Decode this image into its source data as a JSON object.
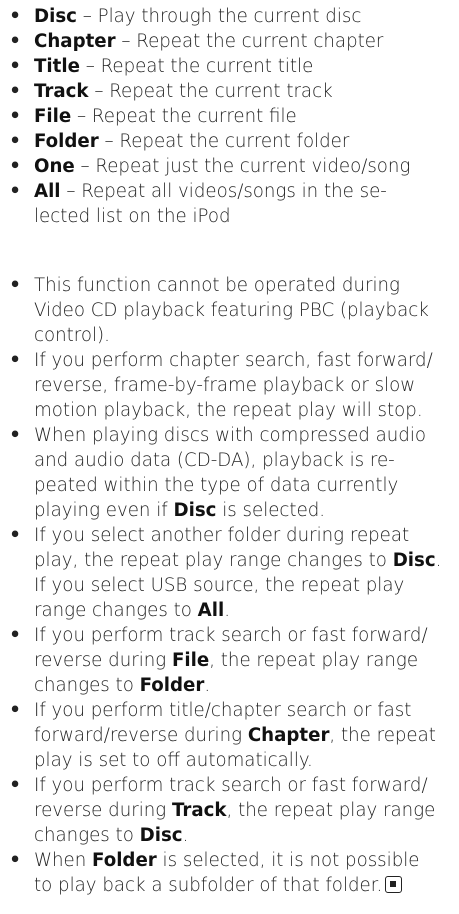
{
  "modes": [
    {
      "term": "Disc",
      "desc": " – Play through the current disc"
    },
    {
      "term": "Chapter",
      "desc": " – Repeat the current chapter"
    },
    {
      "term": "Title",
      "desc": " – Repeat the current title"
    },
    {
      "term": "Track",
      "desc": " – Repeat the current track"
    },
    {
      "term": "File",
      "desc": " – Repeat the current file"
    },
    {
      "term": "Folder",
      "desc": " – Repeat the current folder"
    },
    {
      "term": "One",
      "desc": " – Repeat just the current video/song"
    },
    {
      "term": "All",
      "desc_1": " – Repeat all videos/songs in the se-",
      "desc_2": "lected list on the iPod"
    }
  ],
  "notes": {
    "n1": {
      "l1": "This function cannot be operated during",
      "l2": "Video CD playback featuring PBC (playback",
      "l3": "control)."
    },
    "n2": {
      "l1": "If you perform chapter search, fast forward/",
      "l2": "reverse, frame-by-frame playback or slow",
      "l3": "motion playback, the repeat play will stop."
    },
    "n3": {
      "l1": "When playing discs with compressed audio",
      "l2": "and audio data (CD-DA), playback is re-",
      "l3": "peated within the type of data currently",
      "l4a": "playing even if ",
      "l4b": "Disc",
      "l4c": " is selected."
    },
    "n4": {
      "l1": "If you select another folder during repeat",
      "l2a": "play, the repeat play range changes to ",
      "l2b": "Disc",
      "l2c": ".",
      "l3": "If you select USB source, the repeat play",
      "l4a": "range changes to ",
      "l4b": "All",
      "l4c": "."
    },
    "n5": {
      "l1": "If you perform track search or fast forward/",
      "l2a": "reverse during ",
      "l2b": "File",
      "l2c": ", the repeat play range",
      "l3a": "changes to ",
      "l3b": "Folder",
      "l3c": "."
    },
    "n6": {
      "l1": "If you perform title/chapter search or fast",
      "l2a": "forward/reverse during ",
      "l2b": "Chapter",
      "l2c": ", the repeat",
      "l3": "play is set to off automatically."
    },
    "n7": {
      "l1": "If you perform track search or fast forward/",
      "l2a": "reverse during ",
      "l2b": "Track",
      "l2c": ", the repeat play range",
      "l3a": "changes to ",
      "l3b": "Disc",
      "l3c": "."
    },
    "n8": {
      "l1a": "When ",
      "l1b": "Folder",
      "l1c": " is selected, it is not possible",
      "l2": "to play back a subfolder of that folder."
    }
  }
}
